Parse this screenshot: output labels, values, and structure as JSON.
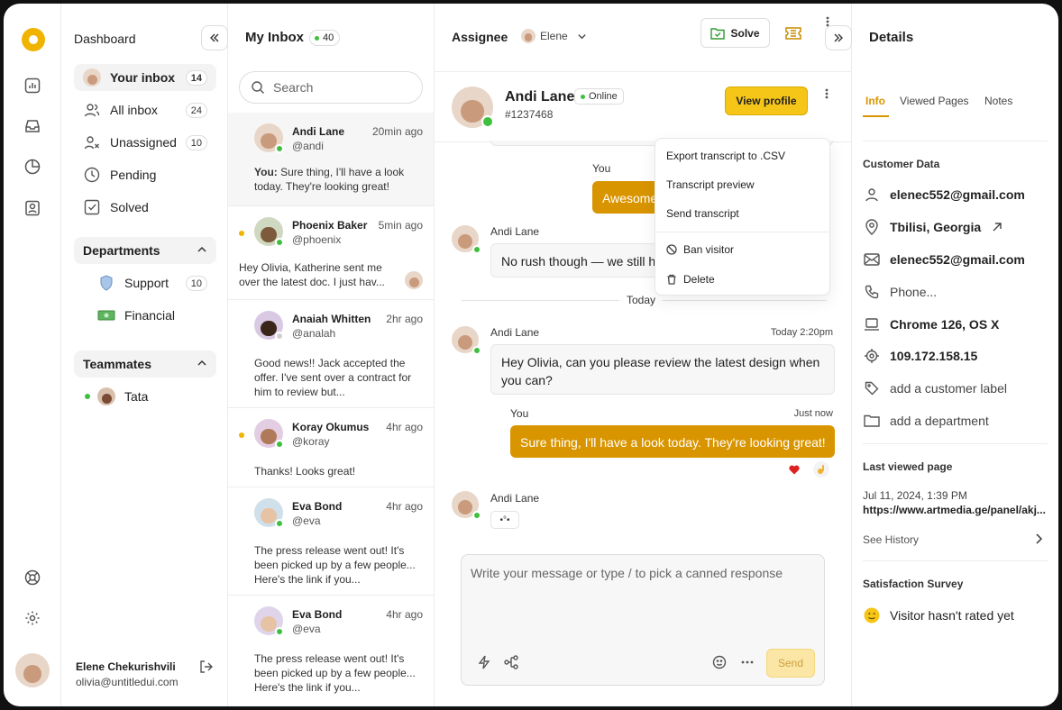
{
  "nav": {
    "title": "Dashboard",
    "items": [
      {
        "label": "Your inbox",
        "count": "14"
      },
      {
        "label": "All inbox",
        "count": "24"
      },
      {
        "label": "Unassigned",
        "count": "10"
      },
      {
        "label": "Pending"
      },
      {
        "label": "Solved"
      }
    ],
    "departments_label": "Departments",
    "departments": [
      {
        "label": "Support",
        "count": "10",
        "icon": "shield-icon"
      },
      {
        "label": "Financial",
        "icon": "money-icon"
      }
    ],
    "teammates_label": "Teammates",
    "teammates": [
      {
        "label": "Tata"
      }
    ],
    "user": {
      "name": "Elene Chekurishvili",
      "email": "olivia@untitledui.com"
    }
  },
  "inbox": {
    "title": "My Inbox",
    "count": "40",
    "search_placeholder": "Search",
    "conversations": [
      {
        "name": "Andi Lane",
        "handle": "@andi",
        "time": "20min ago",
        "msg_prefix": "You:",
        "msg": " Sure thing, I'll have a look today. They're looking great!"
      },
      {
        "name": "Phoenix Baker",
        "handle": "@phoenix",
        "time": "5min ago",
        "msg": "Hey Olivia, Katherine sent me over the latest doc. I just hav..."
      },
      {
        "name": "Anaiah Whitten",
        "handle": "@analah",
        "time": "2hr ago",
        "msg": "Good news!! Jack accepted the offer. I've sent over a contract for him to review but..."
      },
      {
        "name": "Koray Okumus",
        "handle": "@koray",
        "time": "4hr ago",
        "msg": "Thanks! Looks great!"
      },
      {
        "name": "Eva Bond",
        "handle": "@eva",
        "time": "4hr ago",
        "msg": "The press release went out! It's been picked up by a few people... Here's the link if you..."
      },
      {
        "name": "Eva Bond",
        "handle": "@eva",
        "time": "4hr ago",
        "msg": "The press release went out! It's been picked up by a few people... Here's the link if you..."
      }
    ]
  },
  "chat": {
    "assignee_label": "Assignee",
    "assignee": "Elene",
    "solve_label": "Solve",
    "contact_name": "Andi Lane",
    "status": "Online",
    "contact_id": "#1237468",
    "view_profile": "View profile",
    "earlier_you_label": "You",
    "earlier_you_msg": "Awesome!",
    "earlier_andi_name": "Andi Lane",
    "earlier_andi_msg": "No rush though — we still have",
    "divider": "Today",
    "m1_name": "Andi Lane",
    "m1_time": "Today 2:20pm",
    "m1_text": "Hey Olivia, can you please review the latest design when you can?",
    "m2_name": "You",
    "m2_time": "Just now",
    "m2_text": "Sure thing, I'll have a look today. They're looking great!",
    "m3_name": "Andi Lane",
    "typing": "•°•",
    "compose_placeholder": "Write your message or type / to pick a canned response",
    "send_label": "Send",
    "menu": {
      "export": "Export transcript to .CSV",
      "preview": "Transcript preview",
      "send": "Send transcript",
      "ban": "Ban visitor",
      "delete": "Delete"
    }
  },
  "details": {
    "title": "Details",
    "tabs": [
      "Info",
      "Viewed Pages",
      "Notes"
    ],
    "customer_data_label": "Customer Data",
    "email": "elenec552@gmail.com",
    "location": "Tbilisi, Georgia",
    "email2": "elenec552@gmail.com",
    "phone": "Phone...",
    "browser": "Chrome 126, OS X",
    "ip": "109.172.158.15",
    "label_placeholder": "add a customer label",
    "department_placeholder": "add a department",
    "last_viewed_label": "Last viewed page",
    "last_viewed_time": "Jul 11, 2024, 1:39 PM",
    "last_viewed_url": "https://www.artmedia.ge/panel/akj...",
    "see_history": "See History",
    "survey_label": "Satisfaction Survey",
    "survey_text": "Visitor hasn't rated yet"
  },
  "colors": {
    "accent": "#f0b400",
    "bubble_out": "#d99500",
    "online": "#3fbf3f"
  }
}
